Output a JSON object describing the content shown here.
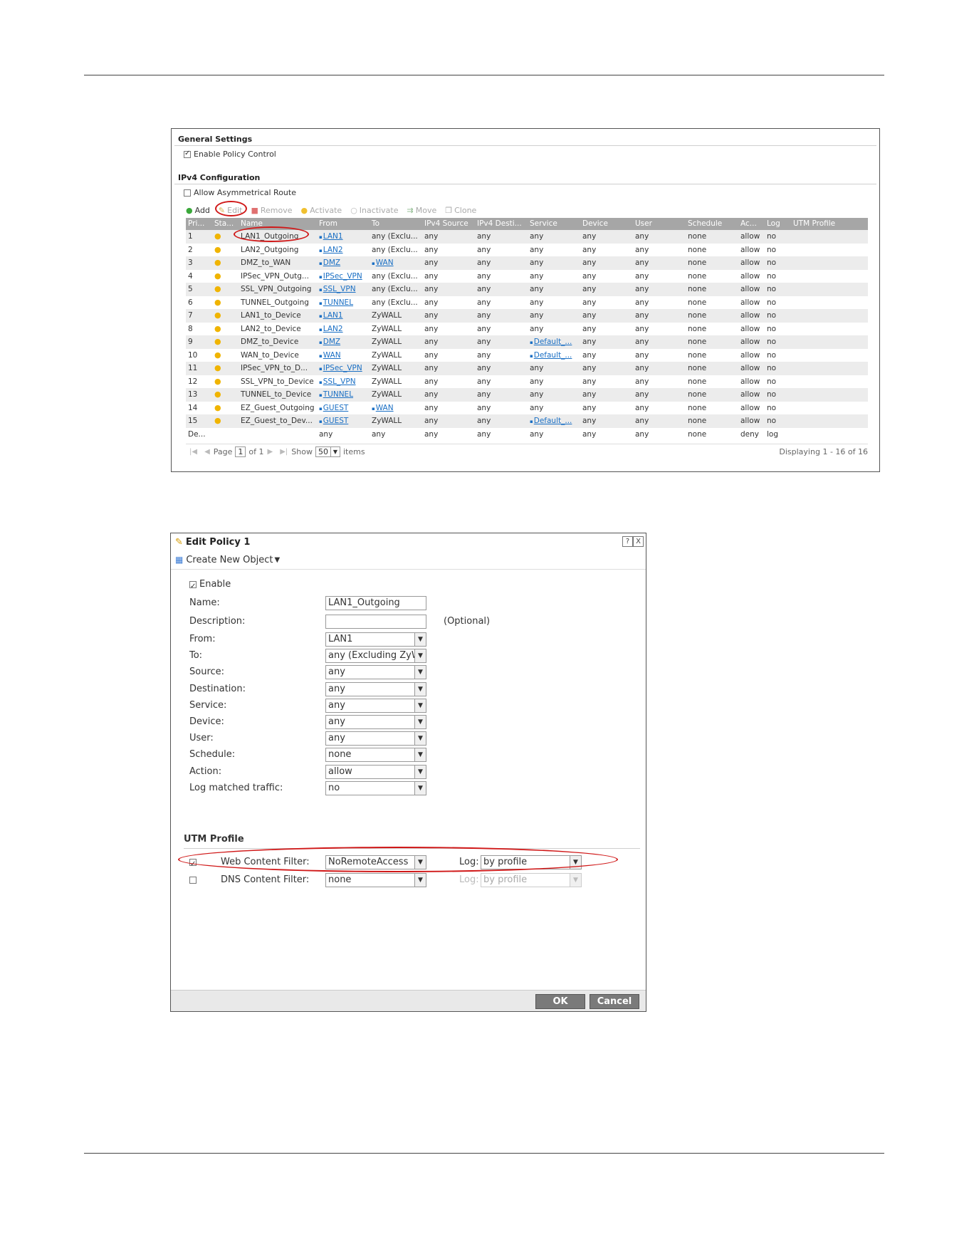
{
  "panel1": {
    "general_settings_title": "General Settings",
    "enable_policy_control": "Enable Policy Control",
    "ipv4_config_title": "IPv4 Configuration",
    "allow_asym_route": "Allow Asymmetrical Route",
    "toolbar": {
      "add": "Add",
      "edit": "Edit",
      "remove": "Remove",
      "activate": "Activate",
      "inactivate": "Inactivate",
      "move": "Move",
      "clone": "Clone"
    },
    "columns": [
      "Pri...",
      "Sta...",
      "Name",
      "From",
      "To",
      "IPv4 Source",
      "IPv4 Desti...",
      "Service",
      "Device",
      "User",
      "Schedule",
      "Ac...",
      "Log",
      "UTM Profile"
    ],
    "rows": [
      [
        "1",
        "",
        "LAN1_Outgoing",
        "LAN1",
        "any (Exclu...",
        "any",
        "any",
        "any",
        "any",
        "any",
        "none",
        "allow",
        "no",
        ""
      ],
      [
        "2",
        "",
        "LAN2_Outgoing",
        "LAN2",
        "any (Exclu...",
        "any",
        "any",
        "any",
        "any",
        "any",
        "none",
        "allow",
        "no",
        ""
      ],
      [
        "3",
        "",
        "DMZ_to_WAN",
        "DMZ",
        "WAN",
        "any",
        "any",
        "any",
        "any",
        "any",
        "none",
        "allow",
        "no",
        ""
      ],
      [
        "4",
        "",
        "IPSec_VPN_Outg...",
        "IPSec_VPN",
        "any (Exclu...",
        "any",
        "any",
        "any",
        "any",
        "any",
        "none",
        "allow",
        "no",
        ""
      ],
      [
        "5",
        "",
        "SSL_VPN_Outgoing",
        "SSL_VPN",
        "any (Exclu...",
        "any",
        "any",
        "any",
        "any",
        "any",
        "none",
        "allow",
        "no",
        ""
      ],
      [
        "6",
        "",
        "TUNNEL_Outgoing",
        "TUNNEL",
        "any (Exclu...",
        "any",
        "any",
        "any",
        "any",
        "any",
        "none",
        "allow",
        "no",
        ""
      ],
      [
        "7",
        "",
        "LAN1_to_Device",
        "LAN1",
        "ZyWALL",
        "any",
        "any",
        "any",
        "any",
        "any",
        "none",
        "allow",
        "no",
        ""
      ],
      [
        "8",
        "",
        "LAN2_to_Device",
        "LAN2",
        "ZyWALL",
        "any",
        "any",
        "any",
        "any",
        "any",
        "none",
        "allow",
        "no",
        ""
      ],
      [
        "9",
        "",
        "DMZ_to_Device",
        "DMZ",
        "ZyWALL",
        "any",
        "any",
        "Default_...",
        "any",
        "any",
        "none",
        "allow",
        "no",
        ""
      ],
      [
        "10",
        "",
        "WAN_to_Device",
        "WAN",
        "ZyWALL",
        "any",
        "any",
        "Default_...",
        "any",
        "any",
        "none",
        "allow",
        "no",
        ""
      ],
      [
        "11",
        "",
        "IPSec_VPN_to_D...",
        "IPSec_VPN",
        "ZyWALL",
        "any",
        "any",
        "any",
        "any",
        "any",
        "none",
        "allow",
        "no",
        ""
      ],
      [
        "12",
        "",
        "SSL_VPN_to_Device",
        "SSL_VPN",
        "ZyWALL",
        "any",
        "any",
        "any",
        "any",
        "any",
        "none",
        "allow",
        "no",
        ""
      ],
      [
        "13",
        "",
        "TUNNEL_to_Device",
        "TUNNEL",
        "ZyWALL",
        "any",
        "any",
        "any",
        "any",
        "any",
        "none",
        "allow",
        "no",
        ""
      ],
      [
        "14",
        "",
        "EZ_Guest_Outgoing",
        "GUEST",
        "WAN",
        "any",
        "any",
        "any",
        "any",
        "any",
        "none",
        "allow",
        "no",
        ""
      ],
      [
        "15",
        "",
        "EZ_Guest_to_Dev...",
        "GUEST",
        "ZyWALL",
        "any",
        "any",
        "Default_...",
        "any",
        "any",
        "none",
        "allow",
        "no",
        ""
      ],
      [
        "De...",
        "",
        "",
        "any",
        "any",
        "any",
        "any",
        "any",
        "any",
        "any",
        "none",
        "deny",
        "log",
        ""
      ]
    ],
    "pager": {
      "page_label": "Page",
      "page_value": "1",
      "of_label": "of 1",
      "show_label": "Show",
      "show_value": "50",
      "items_label": "items",
      "displaying": "Displaying 1 - 16 of 16"
    }
  },
  "panel2": {
    "title": "Edit Policy 1",
    "help_btn": "?",
    "close_btn": "X",
    "create_new_object": "Create New Object",
    "enable_label": "Enable",
    "fields": {
      "name_label": "Name:",
      "name_value": "LAN1_Outgoing",
      "description_label": "Description:",
      "description_value": "",
      "optional_hint": "(Optional)",
      "from_label": "From:",
      "from_value": "LAN1",
      "to_label": "To:",
      "to_value": "any (Excluding ZyW",
      "source_label": "Source:",
      "source_value": "any",
      "destination_label": "Destination:",
      "destination_value": "any",
      "service_label": "Service:",
      "service_value": "any",
      "device_label": "Device:",
      "device_value": "any",
      "user_label": "User:",
      "user_value": "any",
      "schedule_label": "Schedule:",
      "schedule_value": "none",
      "action_label": "Action:",
      "action_value": "allow",
      "log_label": "Log matched traffic:",
      "log_value": "no"
    },
    "utm_profile_title": "UTM Profile",
    "web_filter_label": "Web Content Filter:",
    "web_filter_value": "NoRemoteAccess",
    "web_log_label": "Log:",
    "web_log_value": "by profile",
    "dns_filter_label": "DNS Content Filter:",
    "dns_filter_value": "none",
    "dns_log_label": "Log:",
    "dns_log_value": "by profile",
    "ok_button": "OK",
    "cancel_button": "Cancel"
  },
  "colors": {
    "highlight": "#d01818",
    "link": "#1a6fc4",
    "header_bg": "#a6a6a6",
    "button_bg": "#7a7a7a"
  }
}
